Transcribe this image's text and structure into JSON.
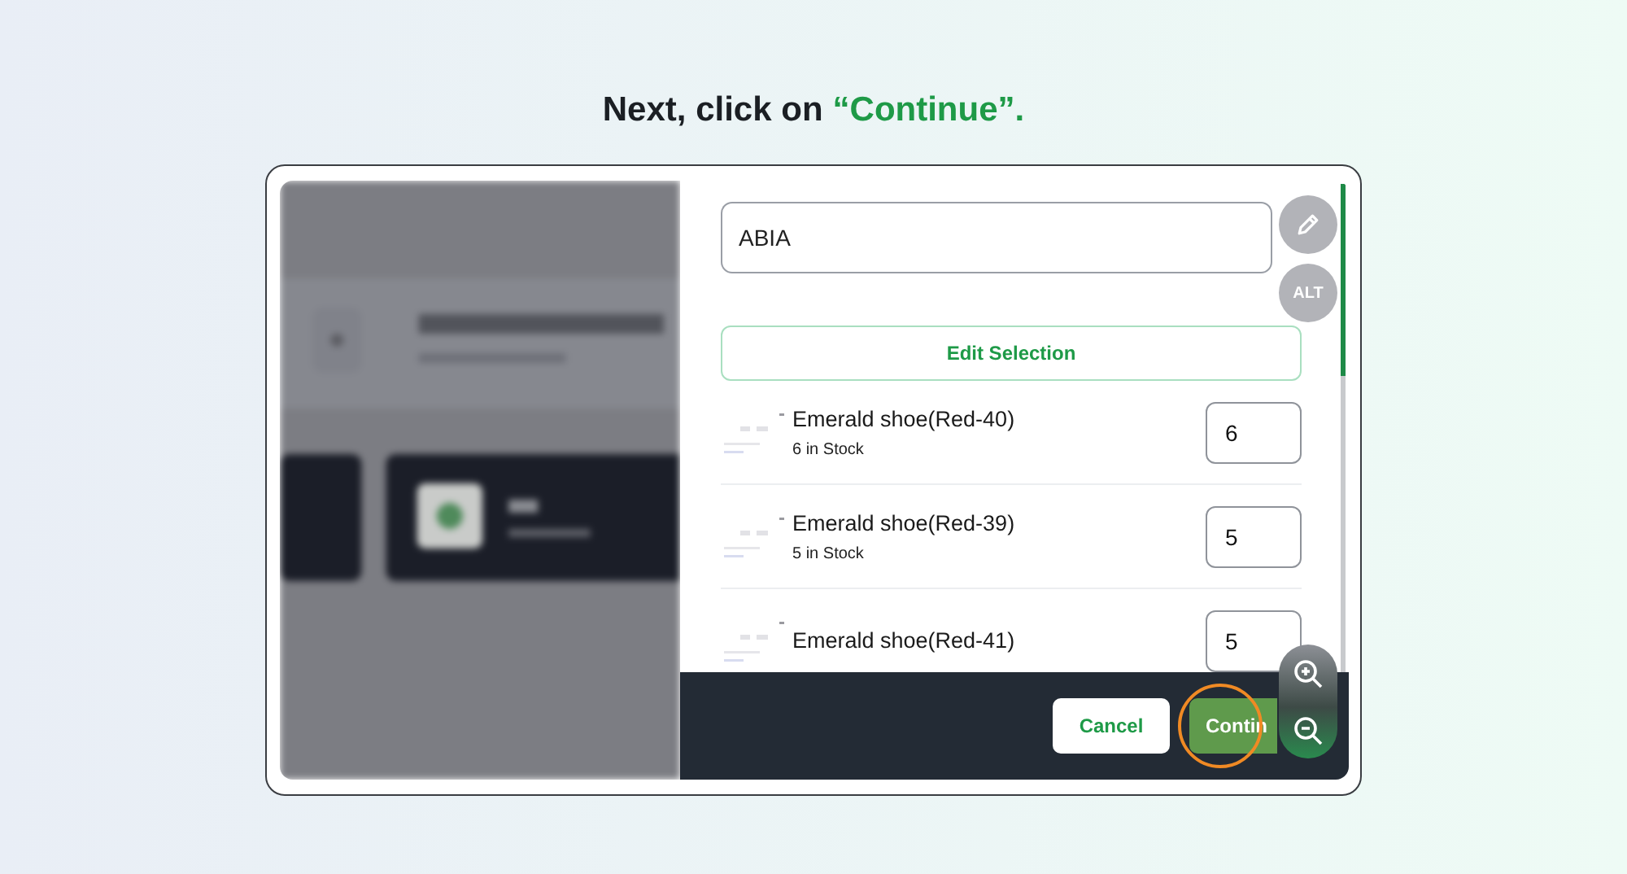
{
  "heading": {
    "text": "Next, click on",
    "highlight": "“Continue”."
  },
  "store_field": {
    "value": "ABIA"
  },
  "alt_badge": "ALT",
  "edit_button": "Edit Selection",
  "items": [
    {
      "name": "Emerald shoe(Red-40)",
      "stock": "6 in Stock",
      "quantity": "6"
    },
    {
      "name": "Emerald shoe(Red-39)",
      "stock": "5 in Stock",
      "quantity": "5"
    },
    {
      "name": "Emerald shoe(Red-41)",
      "quantity": "5"
    }
  ],
  "footer": {
    "cancel": "Cancel",
    "continue": "Contin"
  }
}
